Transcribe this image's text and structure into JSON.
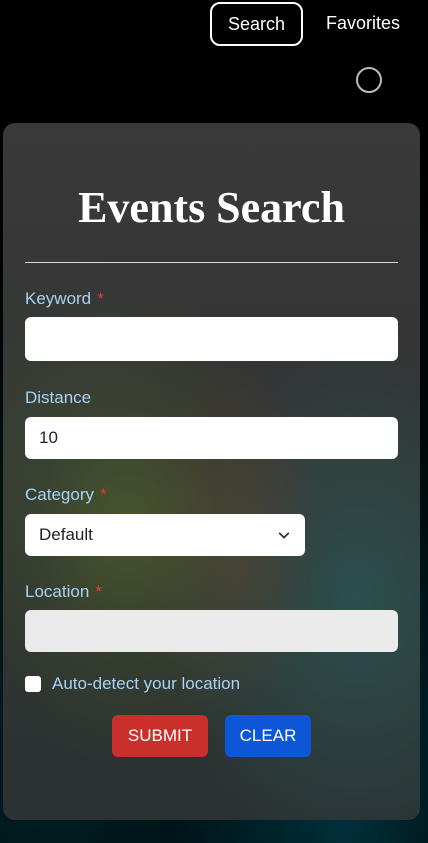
{
  "nav": {
    "search_label": "Search",
    "favorites_label": "Favorites"
  },
  "form": {
    "title": "Events Search",
    "keyword": {
      "label": "Keyword",
      "required_mark": "*",
      "value": ""
    },
    "distance": {
      "label": "Distance",
      "value": "10"
    },
    "category": {
      "label": "Category",
      "required_mark": "*",
      "selected": "Default"
    },
    "location": {
      "label": "Location",
      "required_mark": "*",
      "value": ""
    },
    "auto_detect": {
      "label": "Auto-detect your location",
      "checked": false
    },
    "submit_label": "SUBMIT",
    "clear_label": "CLEAR"
  },
  "colors": {
    "label": "#a9d2f5",
    "required": "#e23b3b",
    "submit": "#c9302c",
    "clear": "#0d57d6"
  }
}
